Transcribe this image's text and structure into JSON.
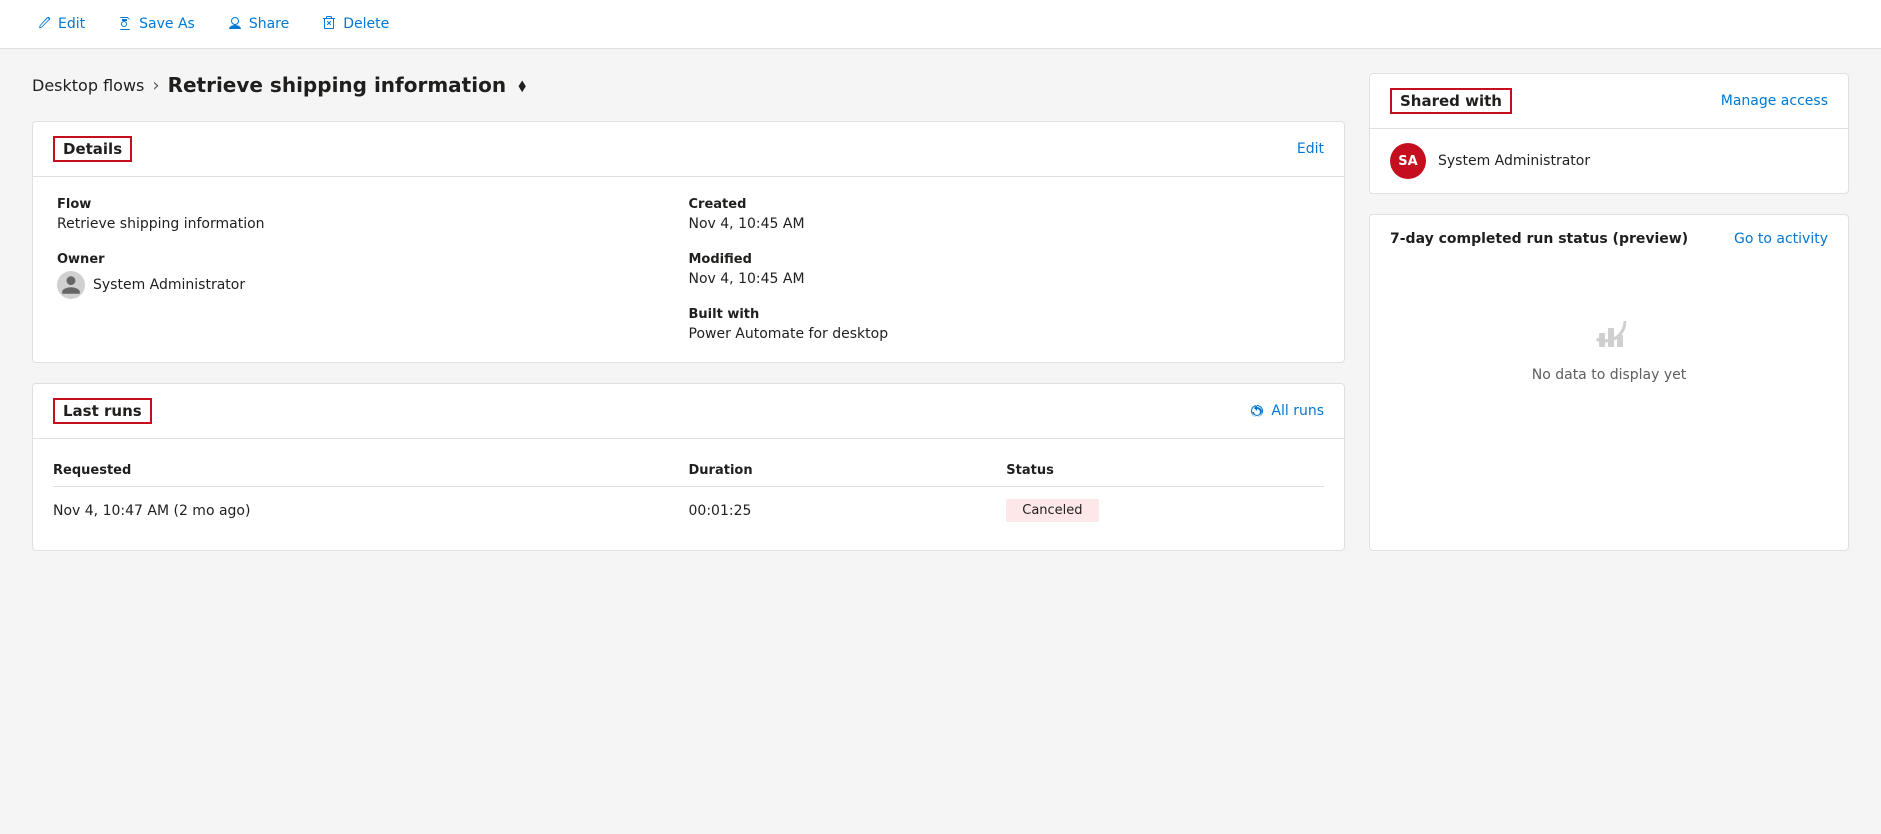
{
  "toolbar": {
    "edit_label": "Edit",
    "save_as_label": "Save As",
    "share_label": "Share",
    "delete_label": "Delete"
  },
  "breadcrumb": {
    "parent": "Desktop flows",
    "current": "Retrieve shipping information"
  },
  "details_card": {
    "title": "Details",
    "edit_link": "Edit",
    "flow_label": "Flow",
    "flow_value": "Retrieve shipping information",
    "owner_label": "Owner",
    "owner_value": "System Administrator",
    "created_label": "Created",
    "created_value": "Nov 4, 10:45 AM",
    "modified_label": "Modified",
    "modified_value": "Nov 4, 10:45 AM",
    "built_with_label": "Built with",
    "built_with_value": "Power Automate for desktop"
  },
  "last_runs_card": {
    "title": "Last runs",
    "all_runs_link": "All runs",
    "requested_col": "Requested",
    "duration_col": "Duration",
    "status_col": "Status",
    "rows": [
      {
        "requested": "Nov 4, 10:47 AM (2 mo ago)",
        "duration": "00:01:25",
        "status": "Canceled"
      }
    ]
  },
  "shared_with_card": {
    "title": "Shared with",
    "manage_access_link": "Manage access",
    "user_initials": "SA",
    "user_name": "System Administrator"
  },
  "run_status_card": {
    "title": "7-day completed run status (preview)",
    "go_to_activity_link": "Go to activity",
    "no_data_text": "No data to display yet"
  }
}
